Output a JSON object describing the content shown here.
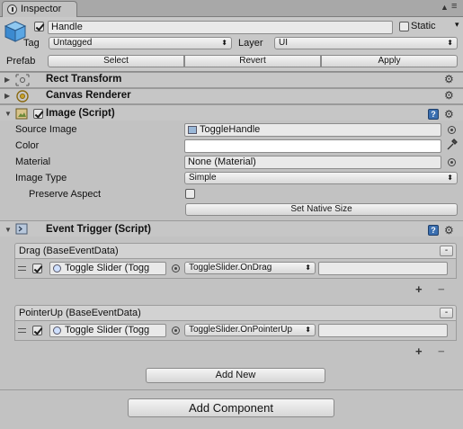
{
  "window": {
    "tab_title": "Inspector",
    "icons": [
      "info-icon",
      "menu-icon",
      "restore-icon",
      "close-icon"
    ]
  },
  "object": {
    "active": true,
    "name": "Handle",
    "static_label": "Static",
    "static_checked": false,
    "tag_label": "Tag",
    "tag_value": "Untagged",
    "layer_label": "Layer",
    "layer_value": "UI",
    "prefab_label": "Prefab",
    "prefab_buttons": [
      "Select",
      "Revert",
      "Apply"
    ]
  },
  "components": {
    "rect_transform": {
      "title": "Rect Transform",
      "icon": "rect-transform-icon"
    },
    "canvas_renderer": {
      "title": "Canvas Renderer",
      "icon": "canvas-renderer-icon"
    },
    "image": {
      "title": "Image (Script)",
      "enabled": true,
      "fields": {
        "source_image_label": "Source Image",
        "source_image_value": "ToggleHandle",
        "color_label": "Color",
        "material_label": "Material",
        "material_value": "None (Material)",
        "image_type_label": "Image Type",
        "image_type_value": "Simple",
        "preserve_aspect_label": "Preserve Aspect",
        "preserve_aspect_checked": false,
        "set_native_size_label": "Set Native Size"
      }
    },
    "event_trigger": {
      "title": "Event Trigger (Script)",
      "events": [
        {
          "header": "Drag (BaseEventData)",
          "target": "Toggle Slider (Togg",
          "function": "ToggleSlider.OnDrag"
        },
        {
          "header": "PointerUp (BaseEventData)",
          "target": "Toggle Slider (Togg",
          "function": "ToggleSlider.OnPointerUp"
        }
      ],
      "add_new_label": "Add New"
    }
  },
  "footer": {
    "add_component_label": "Add Component"
  },
  "colors": {
    "background": "#c2c2c2",
    "help_icon": "#3b6fb0"
  }
}
